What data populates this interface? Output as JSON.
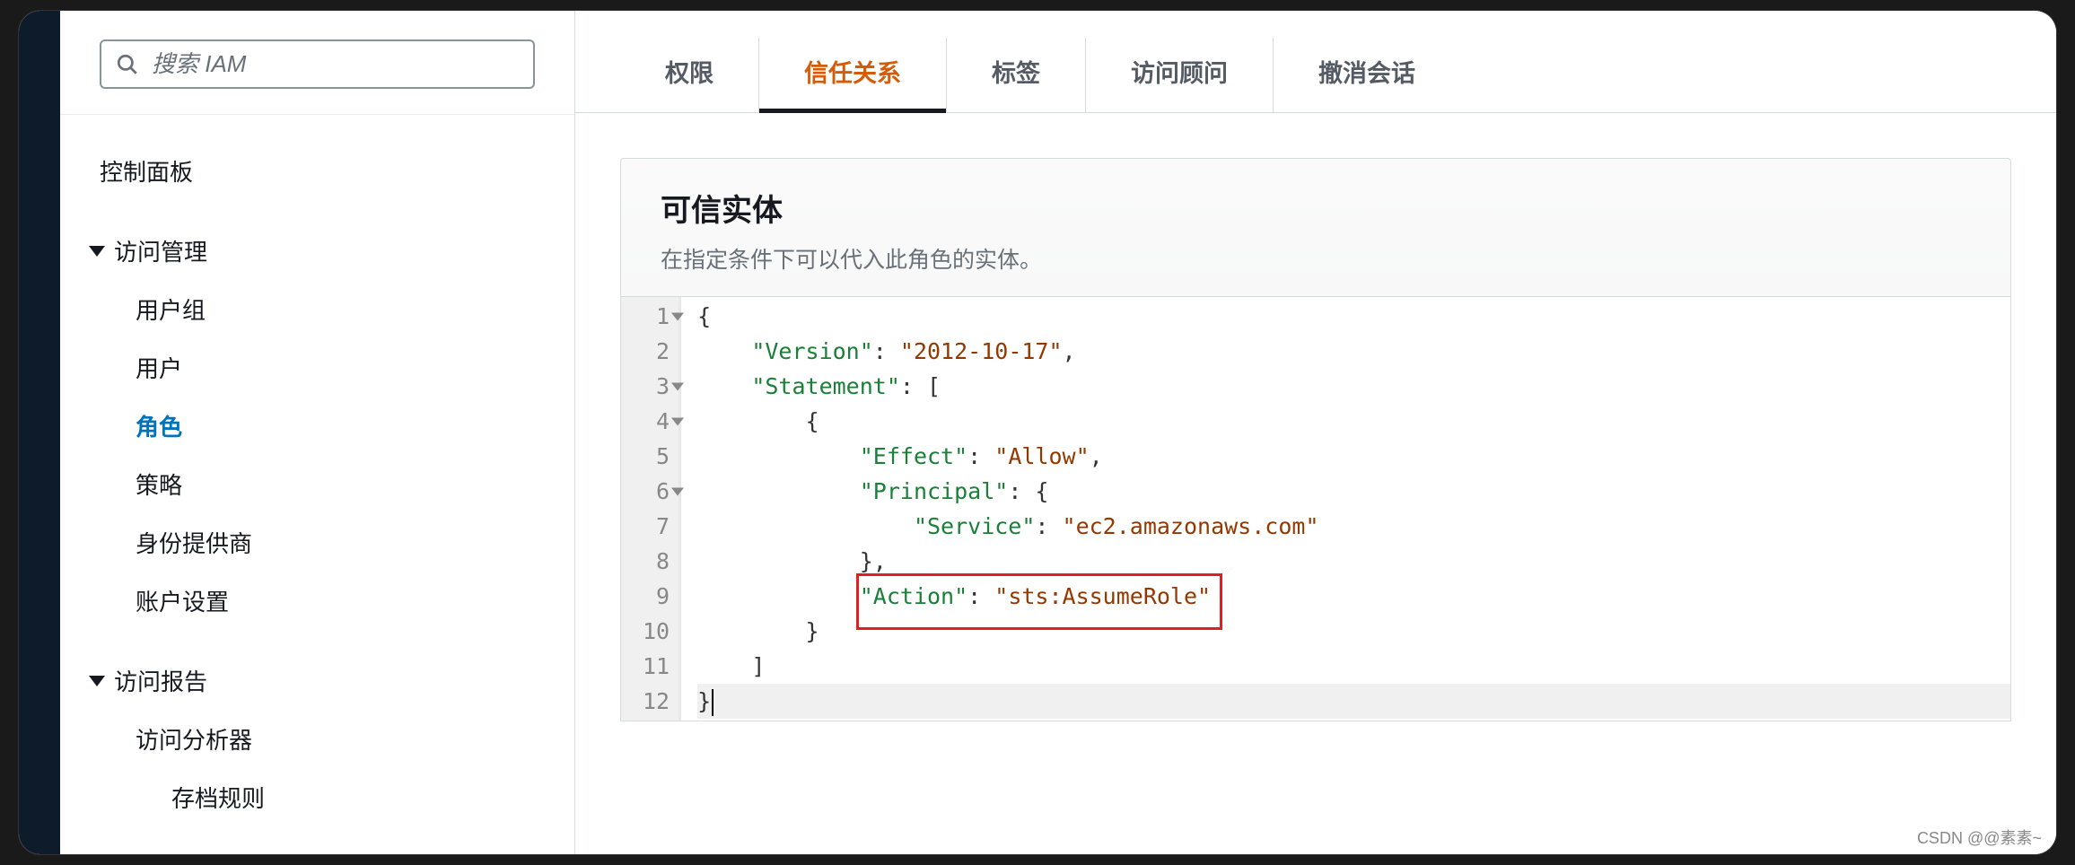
{
  "search": {
    "placeholder": "搜索 IAM"
  },
  "sidebar": {
    "dashboard": "控制面板",
    "access_mgmt": {
      "label": "访问管理",
      "items": [
        "用户组",
        "用户",
        "角色",
        "策略",
        "身份提供商",
        "账户设置"
      ],
      "active_index": 2
    },
    "access_report": {
      "label": "访问报告",
      "items": [
        "访问分析器"
      ],
      "subitems": [
        "存档规则"
      ]
    }
  },
  "tabs": {
    "items": [
      "权限",
      "信任关系",
      "标签",
      "访问顾问",
      "撤消会话"
    ],
    "active_index": 1
  },
  "panel": {
    "title": "可信实体",
    "subtitle": "在指定条件下可以代入此角色的实体。"
  },
  "code": {
    "lines": [
      {
        "n": 1,
        "fold": true,
        "tokens": [
          [
            "{",
            "punc"
          ]
        ]
      },
      {
        "n": 2,
        "tokens": [
          [
            "    ",
            ""
          ],
          [
            "\"Version\"",
            "key"
          ],
          [
            ": ",
            "punc"
          ],
          [
            "\"2012-10-17\"",
            "str"
          ],
          [
            ",",
            "punc"
          ]
        ]
      },
      {
        "n": 3,
        "fold": true,
        "tokens": [
          [
            "    ",
            ""
          ],
          [
            "\"Statement\"",
            "key"
          ],
          [
            ": [",
            "punc"
          ]
        ]
      },
      {
        "n": 4,
        "fold": true,
        "tokens": [
          [
            "        ",
            ""
          ],
          [
            "{",
            "punc"
          ]
        ]
      },
      {
        "n": 5,
        "tokens": [
          [
            "            ",
            ""
          ],
          [
            "\"Effect\"",
            "key"
          ],
          [
            ": ",
            "punc"
          ],
          [
            "\"Allow\"",
            "str"
          ],
          [
            ",",
            "punc"
          ]
        ]
      },
      {
        "n": 6,
        "fold": true,
        "tokens": [
          [
            "            ",
            ""
          ],
          [
            "\"Principal\"",
            "key"
          ],
          [
            ": {",
            "punc"
          ]
        ]
      },
      {
        "n": 7,
        "tokens": [
          [
            "                ",
            ""
          ],
          [
            "\"Service\"",
            "key"
          ],
          [
            ": ",
            "punc"
          ],
          [
            "\"ec2.amazonaws.com\"",
            "str"
          ]
        ]
      },
      {
        "n": 8,
        "tokens": [
          [
            "            ",
            ""
          ],
          [
            "},",
            "punc"
          ]
        ]
      },
      {
        "n": 9,
        "tokens": [
          [
            "            ",
            ""
          ],
          [
            "\"Action\"",
            "key"
          ],
          [
            ": ",
            "punc"
          ],
          [
            "\"sts:AssumeRole\"",
            "str"
          ]
        ]
      },
      {
        "n": 10,
        "tokens": [
          [
            "        ",
            ""
          ],
          [
            "}",
            "punc"
          ]
        ]
      },
      {
        "n": 11,
        "tokens": [
          [
            "    ",
            ""
          ],
          [
            "]",
            "punc"
          ]
        ]
      },
      {
        "n": 12,
        "hl": true,
        "tokens": [
          [
            "}",
            "punc"
          ]
        ]
      }
    ],
    "highlight_box": {
      "top_line": 9,
      "left_ch": 12,
      "width_ch": 27,
      "height_lines": 1.4
    }
  },
  "watermark": "CSDN @@素素~"
}
